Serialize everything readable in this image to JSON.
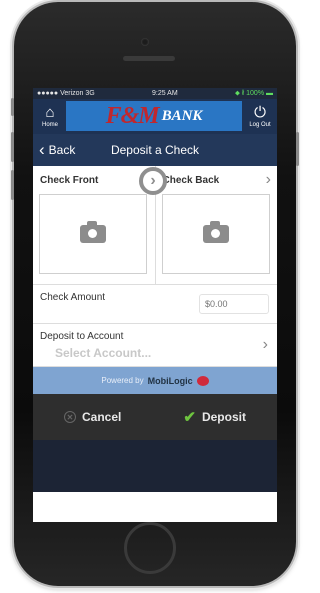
{
  "status_bar": {
    "carrier": "●●●●● Verizon  3G",
    "time": "9:25 AM",
    "battery": "⬥ ∦ 100% ▬"
  },
  "header": {
    "home_label": "Home",
    "logout_label": "Log Out",
    "logo_mark": "F&M",
    "logo_word": "BANK",
    "home_icon": "house-icon",
    "logout_icon": "power-icon"
  },
  "navbar": {
    "back_label": "Back",
    "title": "Deposit a Check"
  },
  "capture": {
    "front_label": "Check Front",
    "back_label": "Check Back",
    "camera_icon": "camera-icon"
  },
  "form": {
    "amount_label": "Check Amount",
    "amount_placeholder": "$0.00",
    "deposit_to_label": "Deposit to Account",
    "deposit_to_value": "Select Account..."
  },
  "footer": {
    "powered_prefix": "Powered by",
    "powered_brand": "MobiLogic"
  },
  "actions": {
    "cancel_label": "Cancel",
    "deposit_label": "Deposit"
  },
  "colors": {
    "header_bg": "#1e3253",
    "logo_bg": "#2a76c4",
    "logo_mark": "#c0272d",
    "deposit_check": "#6ec43f",
    "action_bar": "#2e2e2e"
  }
}
